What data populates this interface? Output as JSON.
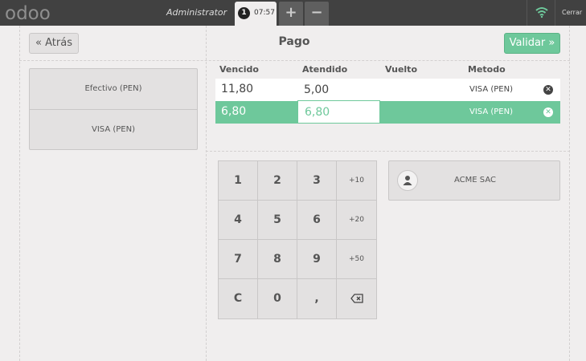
{
  "topbar": {
    "logo_text": "odoo",
    "user": "Administrator",
    "order": {
      "number": "1",
      "time": "07:57"
    },
    "add_label": "+",
    "remove_label": "−",
    "close_label": "Cerrar",
    "wifi_color": "#6ec89b"
  },
  "header": {
    "back_label": "« Atrás",
    "title": "Pago",
    "validate_label": "Validar »",
    "accent": "#6ec89b"
  },
  "payment_methods": [
    "Efectivo (PEN)",
    "VISA (PEN)"
  ],
  "lines": {
    "columns": [
      "Vencido",
      "Atendido",
      "Vuelto",
      "Metodo"
    ],
    "rows": [
      {
        "due": "11,80",
        "tendered": "5,00",
        "change": "",
        "method": "VISA (PEN)",
        "selected": false
      },
      {
        "due": "6,80",
        "tendered": "6,80",
        "change": "",
        "method": "VISA (PEN)",
        "selected": true
      }
    ]
  },
  "numpad": {
    "keys": [
      "1",
      "2",
      "3",
      "+10",
      "4",
      "5",
      "6",
      "+20",
      "7",
      "8",
      "9",
      "+50",
      "C",
      "0",
      ",",
      "⌫"
    ]
  },
  "customer": {
    "name": "ACME SAC"
  }
}
